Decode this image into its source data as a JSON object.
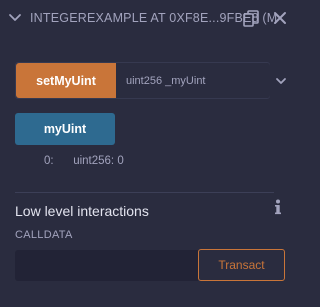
{
  "header": {
    "contract_title": "INTEGEREXAMPLE AT 0XF8E...9FBE8 (M",
    "chevron_icon": "chevron-down-icon",
    "copy_icon": "copy-icon",
    "close_icon": "close-icon"
  },
  "functions": {
    "set_my_uint": {
      "label": "setMyUint",
      "placeholder": "uint256 _myUint",
      "expand_icon": "chevron-down-icon"
    },
    "my_uint": {
      "label": "myUint",
      "result_index": "0:",
      "result_value": "uint256: 0"
    }
  },
  "low_level": {
    "title": "Low level interactions",
    "info_icon": "info-icon",
    "calldata_label": "CALLDATA",
    "calldata_value": "",
    "transact_label": "Transact"
  },
  "colors": {
    "background": "#2a2c3f",
    "transact_button": "#c97539",
    "call_button": "#2e6a90",
    "text_muted": "#a2a3bd",
    "text_bright": "#e3e4ef"
  }
}
